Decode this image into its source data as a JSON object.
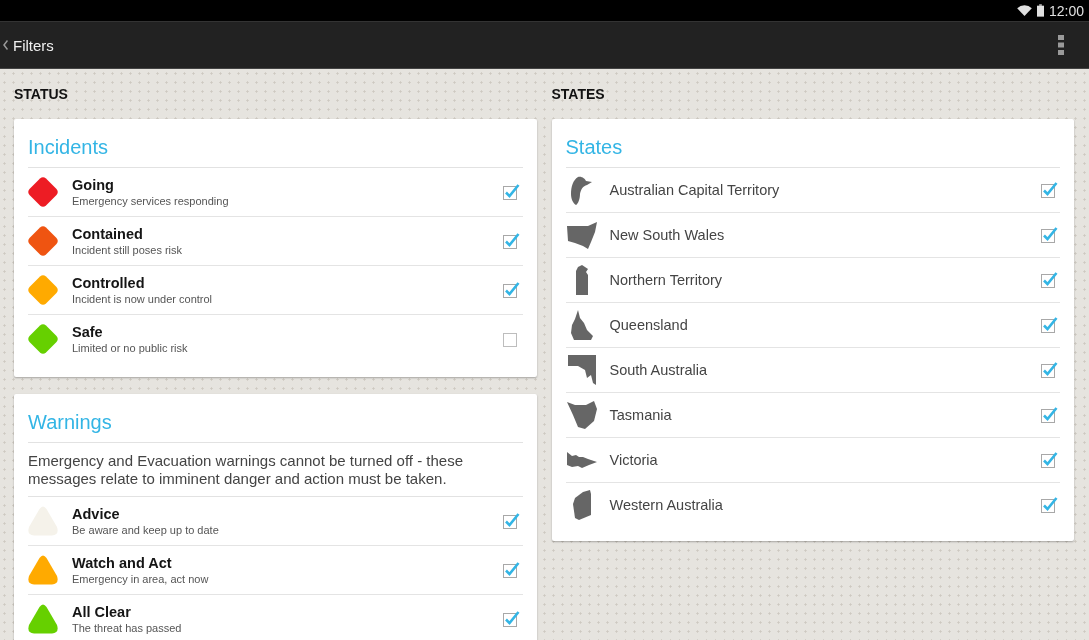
{
  "system_bar": {
    "time": "12:00"
  },
  "action_bar": {
    "title": "Filters"
  },
  "status": {
    "heading": "STATUS",
    "incidents": {
      "title": "Incidents",
      "items": [
        {
          "label": "Going",
          "description": "Emergency services responding",
          "color": "#ed1c24",
          "checked": true
        },
        {
          "label": "Contained",
          "description": "Incident still poses risk",
          "color": "#ef5411",
          "checked": true
        },
        {
          "label": "Controlled",
          "description": "Incident is now under control",
          "color": "#ffaa00",
          "checked": true
        },
        {
          "label": "Safe",
          "description": "Limited or no public risk",
          "color": "#66d000",
          "checked": false
        }
      ]
    },
    "warnings": {
      "title": "Warnings",
      "note": "Emergency and Evacuation warnings cannot be turned off - these messages relate to imminent danger and action must be taken.",
      "items": [
        {
          "label": "Advice",
          "description": "Be aware and keep up to date",
          "color": "#f5f2ea",
          "checked": true
        },
        {
          "label": "Watch and Act",
          "description": "Emergency in area, act now",
          "color": "#ffaa00",
          "checked": true
        },
        {
          "label": "All Clear",
          "description": "The threat has passed",
          "color": "#66d000",
          "checked": true
        }
      ]
    }
  },
  "states": {
    "heading": "STATES",
    "title": "States",
    "items": [
      {
        "label": "Australian Capital Territory",
        "checked": true
      },
      {
        "label": "New South Wales",
        "checked": true
      },
      {
        "label": "Northern Territory",
        "checked": true
      },
      {
        "label": "Queensland",
        "checked": true
      },
      {
        "label": "South Australia",
        "checked": true
      },
      {
        "label": "Tasmania",
        "checked": true
      },
      {
        "label": "Victoria",
        "checked": true
      },
      {
        "label": "Western Australia",
        "checked": true
      }
    ]
  }
}
